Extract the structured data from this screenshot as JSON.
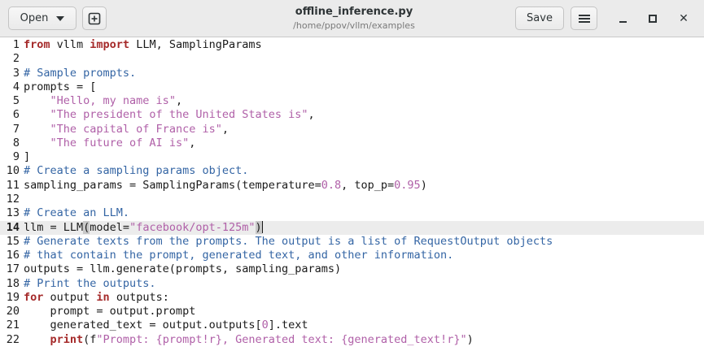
{
  "header": {
    "open_label": "Open",
    "save_label": "Save",
    "title": "offline_inference.py",
    "subtitle": "/home/ppov/vllm/examples",
    "icons": {
      "open_menu": "chevron-down-icon",
      "new_tab": "new-document-icon",
      "menu": "hamburger-menu-icon",
      "minimize": "minimize-icon",
      "maximize": "maximize-icon",
      "close": "close-icon"
    }
  },
  "editor": {
    "language": "python",
    "current_line": 14,
    "colors": {
      "keyword": "#a52a2a",
      "string": "#b060a8",
      "comment": "#3465a4",
      "current_line_bg": "#ececec"
    },
    "lines": [
      {
        "n": "1",
        "tokens": [
          {
            "t": "from",
            "c": "kw"
          },
          {
            "t": " vllm ",
            "c": ""
          },
          {
            "t": "import",
            "c": "kw"
          },
          {
            "t": " LLM, SamplingParams",
            "c": ""
          }
        ]
      },
      {
        "n": "2",
        "tokens": []
      },
      {
        "n": "3",
        "tokens": [
          {
            "t": "# Sample prompts.",
            "c": "cmt"
          }
        ]
      },
      {
        "n": "4",
        "tokens": [
          {
            "t": "prompts = [",
            "c": ""
          }
        ]
      },
      {
        "n": "5",
        "tokens": [
          {
            "t": "    ",
            "c": ""
          },
          {
            "t": "\"Hello, my name is\"",
            "c": "str"
          },
          {
            "t": ",",
            "c": ""
          }
        ]
      },
      {
        "n": "6",
        "tokens": [
          {
            "t": "    ",
            "c": ""
          },
          {
            "t": "\"The president of the United States is\"",
            "c": "str"
          },
          {
            "t": ",",
            "c": ""
          }
        ]
      },
      {
        "n": "7",
        "tokens": [
          {
            "t": "    ",
            "c": ""
          },
          {
            "t": "\"The capital of France is\"",
            "c": "str"
          },
          {
            "t": ",",
            "c": ""
          }
        ]
      },
      {
        "n": "8",
        "tokens": [
          {
            "t": "    ",
            "c": ""
          },
          {
            "t": "\"The future of AI is\"",
            "c": "str"
          },
          {
            "t": ",",
            "c": ""
          }
        ]
      },
      {
        "n": "9",
        "tokens": [
          {
            "t": "]",
            "c": ""
          }
        ]
      },
      {
        "n": "10",
        "tokens": [
          {
            "t": "# Create a sampling params object.",
            "c": "cmt"
          }
        ]
      },
      {
        "n": "11",
        "tokens": [
          {
            "t": "sampling_params = SamplingParams(temperature=",
            "c": ""
          },
          {
            "t": "0.8",
            "c": "num"
          },
          {
            "t": ", top_p=",
            "c": ""
          },
          {
            "t": "0.95",
            "c": "num"
          },
          {
            "t": ")",
            "c": ""
          }
        ]
      },
      {
        "n": "12",
        "tokens": []
      },
      {
        "n": "13",
        "tokens": [
          {
            "t": "# Create an LLM.",
            "c": "cmt"
          }
        ]
      },
      {
        "n": "14",
        "tokens": [
          {
            "t": "llm = LLM",
            "c": ""
          },
          {
            "t": "(",
            "c": "bm"
          },
          {
            "t": "model=",
            "c": ""
          },
          {
            "t": "\"facebook/opt-125m\"",
            "c": "str"
          },
          {
            "t": ")",
            "c": "bm"
          },
          {
            "t": "",
            "c": "cursor"
          }
        ]
      },
      {
        "n": "15",
        "tokens": [
          {
            "t": "# Generate texts from the prompts. The output is a list of RequestOutput objects",
            "c": "cmt"
          }
        ]
      },
      {
        "n": "16",
        "tokens": [
          {
            "t": "# that contain the prompt, generated text, and other information.",
            "c": "cmt"
          }
        ]
      },
      {
        "n": "17",
        "tokens": [
          {
            "t": "outputs = llm.generate(prompts, sampling_params)",
            "c": ""
          }
        ]
      },
      {
        "n": "18",
        "tokens": [
          {
            "t": "# Print the outputs.",
            "c": "cmt"
          }
        ]
      },
      {
        "n": "19",
        "tokens": [
          {
            "t": "for",
            "c": "kw"
          },
          {
            "t": " output ",
            "c": ""
          },
          {
            "t": "in",
            "c": "kw"
          },
          {
            "t": " outputs:",
            "c": ""
          }
        ]
      },
      {
        "n": "20",
        "tokens": [
          {
            "t": "    prompt = output.prompt",
            "c": ""
          }
        ]
      },
      {
        "n": "21",
        "tokens": [
          {
            "t": "    generated_text = output.outputs[",
            "c": ""
          },
          {
            "t": "0",
            "c": "num"
          },
          {
            "t": "].text",
            "c": ""
          }
        ]
      },
      {
        "n": "22",
        "tokens": [
          {
            "t": "    ",
            "c": ""
          },
          {
            "t": "print",
            "c": "bi"
          },
          {
            "t": "(f",
            "c": ""
          },
          {
            "t": "\"Prompt: {prompt!r}, Generated text: {generated_text!r}\"",
            "c": "str"
          },
          {
            "t": ")",
            "c": ""
          }
        ]
      }
    ]
  }
}
